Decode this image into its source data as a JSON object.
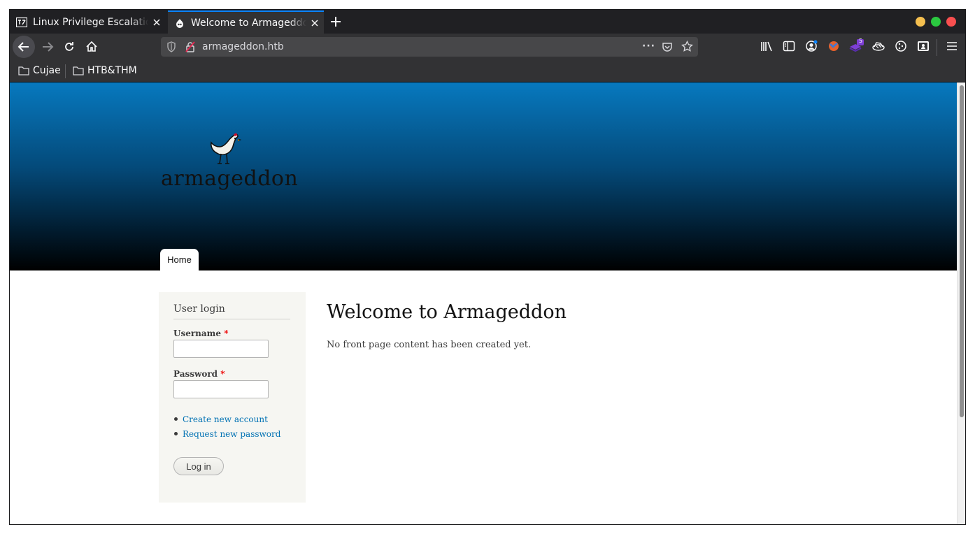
{
  "browser": {
    "tabs": [
      {
        "title": "Linux Privilege Escalation",
        "favicon": "htb-icon"
      },
      {
        "title": "Welcome to Armageddon",
        "favicon": "drupal-icon",
        "active": true
      }
    ],
    "url": "armageddon.htb",
    "bookmarks": [
      "Cujae",
      "HTB&THM"
    ],
    "window_controls": {
      "minimize": "#f5bf4f",
      "maximize": "#2bc840",
      "close": "#f94f4f"
    },
    "extension_badge": "5"
  },
  "site": {
    "logo_text": "armageddon",
    "nav": [
      "Home"
    ]
  },
  "login": {
    "title": "User login",
    "username_label": "Username",
    "password_label": "Password",
    "required_mark": "*",
    "links": [
      "Create new account",
      "Request new password"
    ],
    "submit": "Log in"
  },
  "main": {
    "title": "Welcome to Armageddon",
    "body": "No front page content has been created yet."
  }
}
